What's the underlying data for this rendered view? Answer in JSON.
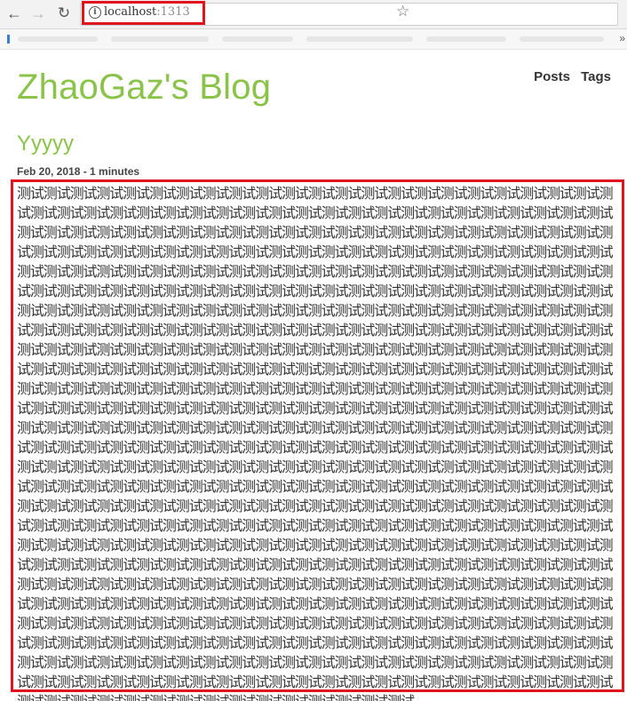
{
  "browser": {
    "url_host": "localhost",
    "url_port": ":1313",
    "back_glyph": "←",
    "forward_glyph": "→",
    "reload_glyph": "↻",
    "info_glyph": "i",
    "star_glyph": "☆",
    "more_glyph": "»"
  },
  "site": {
    "title": "ZhaoGaz's Blog",
    "nav": [
      "Posts",
      "Tags"
    ]
  },
  "post": {
    "title": "Yyyyy",
    "meta": "Feb 20, 2018 - 1 minutes",
    "body_unit": "测试",
    "body_repeat": 600
  },
  "colors": {
    "accent": "#8bc34a",
    "highlight": "#e0141f"
  }
}
